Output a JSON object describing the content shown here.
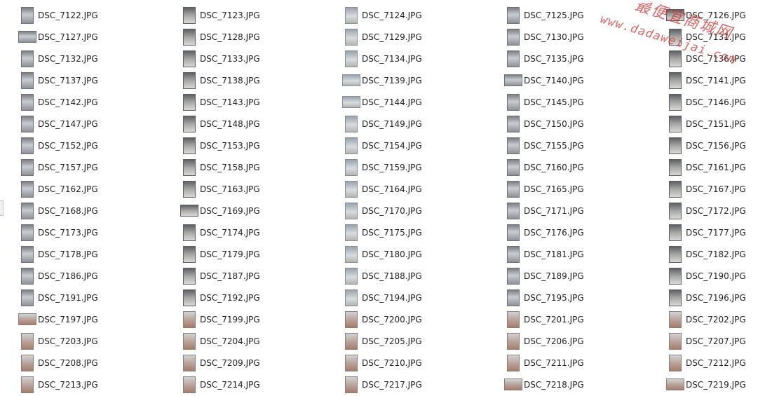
{
  "files": [
    {
      "name": "DSC_7122.JPG",
      "thumb_orientation": "portrait"
    },
    {
      "name": "DSC_7123.JPG",
      "thumb_orientation": "portrait"
    },
    {
      "name": "DSC_7124.JPG",
      "thumb_orientation": "portrait"
    },
    {
      "name": "DSC_7125.JPG",
      "thumb_orientation": "portrait"
    },
    {
      "name": "DSC_7126.JPG",
      "thumb_orientation": "landscape"
    },
    {
      "name": "DSC_7127.JPG",
      "thumb_orientation": "landscape"
    },
    {
      "name": "DSC_7128.JPG",
      "thumb_orientation": "portrait"
    },
    {
      "name": "DSC_7129.JPG",
      "thumb_orientation": "portrait"
    },
    {
      "name": "DSC_7130.JPG",
      "thumb_orientation": "portrait"
    },
    {
      "name": "DSC_7131.JPG",
      "thumb_orientation": "portrait"
    },
    {
      "name": "DSC_7132.JPG",
      "thumb_orientation": "portrait"
    },
    {
      "name": "DSC_7133.JPG",
      "thumb_orientation": "portrait"
    },
    {
      "name": "DSC_7134.JPG",
      "thumb_orientation": "portrait"
    },
    {
      "name": "DSC_7135.JPG",
      "thumb_orientation": "portrait"
    },
    {
      "name": "DSC_7136.JPG",
      "thumb_orientation": "portrait"
    },
    {
      "name": "DSC_7137.JPG",
      "thumb_orientation": "portrait"
    },
    {
      "name": "DSC_7138.JPG",
      "thumb_orientation": "portrait"
    },
    {
      "name": "DSC_7139.JPG",
      "thumb_orientation": "landscape"
    },
    {
      "name": "DSC_7140.JPG",
      "thumb_orientation": "landscape"
    },
    {
      "name": "DSC_7141.JPG",
      "thumb_orientation": "portrait"
    },
    {
      "name": "DSC_7142.JPG",
      "thumb_orientation": "portrait"
    },
    {
      "name": "DSC_7143.JPG",
      "thumb_orientation": "portrait"
    },
    {
      "name": "DSC_7144.JPG",
      "thumb_orientation": "landscape"
    },
    {
      "name": "DSC_7145.JPG",
      "thumb_orientation": "portrait"
    },
    {
      "name": "DSC_7146.JPG",
      "thumb_orientation": "portrait"
    },
    {
      "name": "DSC_7147.JPG",
      "thumb_orientation": "portrait"
    },
    {
      "name": "DSC_7148.JPG",
      "thumb_orientation": "portrait"
    },
    {
      "name": "DSC_7149.JPG",
      "thumb_orientation": "portrait"
    },
    {
      "name": "DSC_7150.JPG",
      "thumb_orientation": "portrait"
    },
    {
      "name": "DSC_7151.JPG",
      "thumb_orientation": "portrait"
    },
    {
      "name": "DSC_7152.JPG",
      "thumb_orientation": "portrait"
    },
    {
      "name": "DSC_7153.JPG",
      "thumb_orientation": "portrait"
    },
    {
      "name": "DSC_7154.JPG",
      "thumb_orientation": "portrait"
    },
    {
      "name": "DSC_7155.JPG",
      "thumb_orientation": "portrait"
    },
    {
      "name": "DSC_7156.JPG",
      "thumb_orientation": "portrait"
    },
    {
      "name": "DSC_7157.JPG",
      "thumb_orientation": "portrait"
    },
    {
      "name": "DSC_7158.JPG",
      "thumb_orientation": "portrait"
    },
    {
      "name": "DSC_7159.JPG",
      "thumb_orientation": "portrait"
    },
    {
      "name": "DSC_7160.JPG",
      "thumb_orientation": "portrait"
    },
    {
      "name": "DSC_7161.JPG",
      "thumb_orientation": "portrait"
    },
    {
      "name": "DSC_7162.JPG",
      "thumb_orientation": "portrait"
    },
    {
      "name": "DSC_7163.JPG",
      "thumb_orientation": "portrait"
    },
    {
      "name": "DSC_7164.JPG",
      "thumb_orientation": "portrait"
    },
    {
      "name": "DSC_7165.JPG",
      "thumb_orientation": "portrait"
    },
    {
      "name": "DSC_7167.JPG",
      "thumb_orientation": "portrait"
    },
    {
      "name": "DSC_7168.JPG",
      "thumb_orientation": "portrait"
    },
    {
      "name": "DSC_7169.JPG",
      "thumb_orientation": "landscape"
    },
    {
      "name": "DSC_7170.JPG",
      "thumb_orientation": "portrait"
    },
    {
      "name": "DSC_7171.JPG",
      "thumb_orientation": "portrait"
    },
    {
      "name": "DSC_7172.JPG",
      "thumb_orientation": "portrait"
    },
    {
      "name": "DSC_7173.JPG",
      "thumb_orientation": "portrait"
    },
    {
      "name": "DSC_7174.JPG",
      "thumb_orientation": "portrait"
    },
    {
      "name": "DSC_7175.JPG",
      "thumb_orientation": "portrait"
    },
    {
      "name": "DSC_7176.JPG",
      "thumb_orientation": "portrait"
    },
    {
      "name": "DSC_7177.JPG",
      "thumb_orientation": "portrait"
    },
    {
      "name": "DSC_7178.JPG",
      "thumb_orientation": "portrait"
    },
    {
      "name": "DSC_7179.JPG",
      "thumb_orientation": "portrait"
    },
    {
      "name": "DSC_7180.JPG",
      "thumb_orientation": "portrait"
    },
    {
      "name": "DSC_7181.JPG",
      "thumb_orientation": "portrait"
    },
    {
      "name": "DSC_7182.JPG",
      "thumb_orientation": "portrait"
    },
    {
      "name": "DSC_7186.JPG",
      "thumb_orientation": "portrait"
    },
    {
      "name": "DSC_7187.JPG",
      "thumb_orientation": "portrait"
    },
    {
      "name": "DSC_7188.JPG",
      "thumb_orientation": "portrait"
    },
    {
      "name": "DSC_7189.JPG",
      "thumb_orientation": "portrait"
    },
    {
      "name": "DSC_7190.JPG",
      "thumb_orientation": "portrait"
    },
    {
      "name": "DSC_7191.JPG",
      "thumb_orientation": "portrait"
    },
    {
      "name": "DSC_7192.JPG",
      "thumb_orientation": "portrait"
    },
    {
      "name": "DSC_7194.JPG",
      "thumb_orientation": "portrait"
    },
    {
      "name": "DSC_7195.JPG",
      "thumb_orientation": "portrait"
    },
    {
      "name": "DSC_7196.JPG",
      "thumb_orientation": "portrait"
    },
    {
      "name": "DSC_7197.JPG",
      "thumb_orientation": "landscape"
    },
    {
      "name": "DSC_7199.JPG",
      "thumb_orientation": "portrait"
    },
    {
      "name": "DSC_7200.JPG",
      "thumb_orientation": "portrait"
    },
    {
      "name": "DSC_7201.JPG",
      "thumb_orientation": "portrait"
    },
    {
      "name": "DSC_7202.JPG",
      "thumb_orientation": "portrait"
    },
    {
      "name": "DSC_7203.JPG",
      "thumb_orientation": "portrait"
    },
    {
      "name": "DSC_7204.JPG",
      "thumb_orientation": "portrait"
    },
    {
      "name": "DSC_7205.JPG",
      "thumb_orientation": "portrait"
    },
    {
      "name": "DSC_7206.JPG",
      "thumb_orientation": "portrait"
    },
    {
      "name": "DSC_7207.JPG",
      "thumb_orientation": "portrait"
    },
    {
      "name": "DSC_7208.JPG",
      "thumb_orientation": "portrait"
    },
    {
      "name": "DSC_7209.JPG",
      "thumb_orientation": "portrait"
    },
    {
      "name": "DSC_7210.JPG",
      "thumb_orientation": "portrait"
    },
    {
      "name": "DSC_7211.JPG",
      "thumb_orientation": "portrait"
    },
    {
      "name": "DSC_7212.JPG",
      "thumb_orientation": "portrait"
    },
    {
      "name": "DSC_7213.JPG",
      "thumb_orientation": "portrait"
    },
    {
      "name": "DSC_7214.JPG",
      "thumb_orientation": "portrait"
    },
    {
      "name": "DSC_7217.JPG",
      "thumb_orientation": "portrait"
    },
    {
      "name": "DSC_7218.JPG",
      "thumb_orientation": "landscape"
    },
    {
      "name": "DSC_7219.JPG",
      "thumb_orientation": "landscape"
    }
  ],
  "watermark": {
    "title": "最便宜商城网",
    "url": "www.dadaweijai.com",
    "color": "#d9534f"
  },
  "colors": {
    "background": "#ffffff",
    "text": "#1e1e1e"
  }
}
